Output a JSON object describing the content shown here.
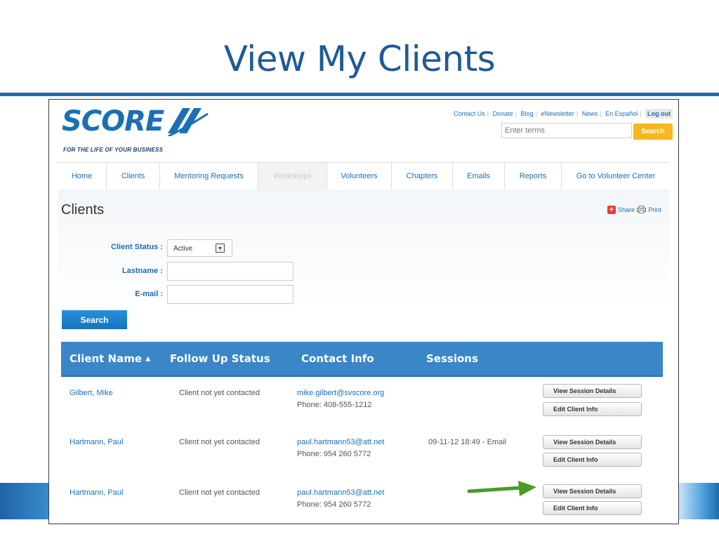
{
  "slide": {
    "title": "View My Clients"
  },
  "logo": {
    "name": "SCORE",
    "tagline": "FOR THE LIFE OF YOUR BUSINESS"
  },
  "utility_links": [
    "Contact Us",
    "Donate",
    "Blog",
    "eNewsletter",
    "News",
    "En Español"
  ],
  "logout_label": "Log out",
  "site_search": {
    "placeholder": "Enter terms",
    "button": "Search"
  },
  "nav": [
    {
      "label": "Home",
      "enabled": true
    },
    {
      "label": "Clients",
      "enabled": true
    },
    {
      "label": "Mentoring Requests",
      "enabled": true
    },
    {
      "label": "Workshops",
      "enabled": false
    },
    {
      "label": "Volunteers",
      "enabled": true
    },
    {
      "label": "Chapters",
      "enabled": true
    },
    {
      "label": "Emails",
      "enabled": true
    },
    {
      "label": "Reports",
      "enabled": true
    },
    {
      "label": "Go to Volunteer Center",
      "enabled": true
    }
  ],
  "page": {
    "heading": "Clients",
    "share": "Share",
    "print": "Print"
  },
  "filters": {
    "status_label": "Client Status :",
    "status_value": "Active",
    "lastname_label": "Lastname :",
    "email_label": "E-mail :",
    "search_button": "Search"
  },
  "table": {
    "headers": [
      "Client Name",
      "Follow Up Status",
      "Contact Info",
      "Sessions"
    ],
    "sort_indicator": "▲",
    "rows": [
      {
        "name": "Gilbert, Mike",
        "status": "Client not yet contacted",
        "email": "mike.gilbert@svscore.org",
        "phone": "Phone: 408-555-1212",
        "sessions": ""
      },
      {
        "name": "Hartmann, Paul",
        "status": "Client not yet contacted",
        "email": "paul.hartmann53@att.net",
        "phone": "Phone: 954 260 5772",
        "sessions": "09-11-12 18:49 - Email"
      },
      {
        "name": "Hartmann, Paul",
        "status": "Client not yet contacted",
        "email": "paul.hartmann53@att.net",
        "phone": "Phone: 954 260 5772",
        "sessions": ""
      }
    ],
    "view_button": "View Session Details",
    "edit_button": "Edit Client Info"
  },
  "colors": {
    "brand_blue": "#1a6fb5",
    "header_blue": "#3a86c7",
    "accent_orange": "#f6b81c",
    "arrow_green": "#4a9a28"
  }
}
